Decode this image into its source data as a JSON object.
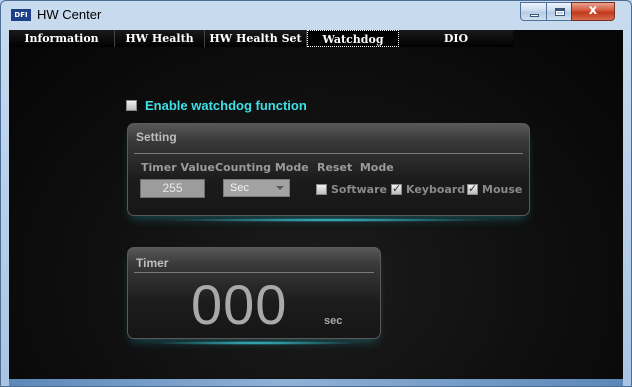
{
  "window": {
    "title": "HW Center",
    "logo_text": "DFI",
    "close_glyph": "x"
  },
  "tabs": [
    {
      "label": "Information",
      "active": false
    },
    {
      "label": "HW Health",
      "active": false
    },
    {
      "label": "HW Health Set",
      "active": false
    },
    {
      "label": "Watchdog",
      "active": true
    },
    {
      "label": "DIO",
      "active": false
    }
  ],
  "watchdog": {
    "enable_label": "Enable watchdog function",
    "enabled": false,
    "setting": {
      "title": "Setting",
      "timer_value_header": "Timer Value",
      "counting_mode_header": "Counting Mode",
      "reset_mode_header": "Reset  Mode",
      "timer_value": "255",
      "counting_mode": "Sec",
      "reset_options": [
        {
          "label": "Software",
          "checked": false
        },
        {
          "label": "Keyboard",
          "checked": true
        },
        {
          "label": "Mouse",
          "checked": true
        }
      ]
    },
    "timer": {
      "title": "Timer",
      "value": "000",
      "unit": "sec"
    }
  },
  "colors": {
    "accent_cyan": "#3fe0e6",
    "background": "#0d0d0d",
    "panel_text": "#bdbdbd"
  },
  "icons": [
    "app-logo-icon",
    "minimize-icon",
    "maximize-icon",
    "close-icon",
    "chevron-down-icon"
  ]
}
